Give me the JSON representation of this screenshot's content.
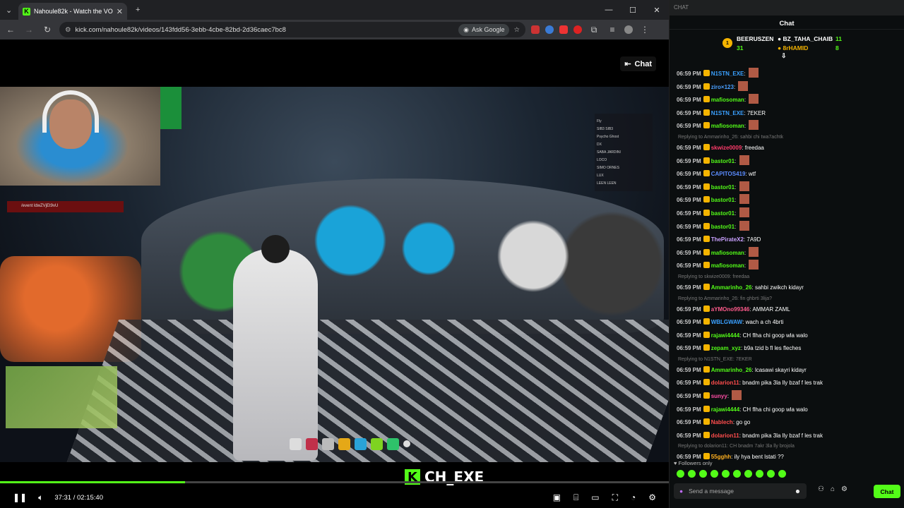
{
  "browser": {
    "tab_title": "Nahoule82k - Watch the VO",
    "url": "kick.com/nahoule82k/videos/143fdd56-3ebb-4cbe-82bd-2d36caec7bc8",
    "ask_google": "Ask Google"
  },
  "player": {
    "chat_toggle": "Chat",
    "game_command": "/event ldwZVjEt9vU",
    "brand_text": "CH_EXE",
    "brand_letter": "K",
    "time_current": "37:31",
    "time_separator": "/",
    "time_total": "02:15:40",
    "progress_percent": 27.7,
    "player_list": [
      "Fly",
      "SIB3 SIB3",
      "Psycho Ghost",
      "DX",
      "SABA JARDINI",
      "LOCO",
      "SIMO ORNES",
      "LUX",
      "LEEN LEEN"
    ]
  },
  "chat": {
    "header_label": "CHAT",
    "title": "Chat",
    "top_gifter_rank": "1",
    "gifters": [
      {
        "name": "BEERUSZEN",
        "count": "31"
      },
      {
        "name": "BZ_TAHA_CHAIB",
        "count": "11"
      },
      {
        "name": "8rHAMID",
        "count": "8"
      }
    ],
    "messages": [
      {
        "time": "06:59 PM",
        "user": "N1STN_EXE",
        "text": "",
        "color": "#3aa0ff",
        "emote": true,
        "reply": ""
      },
      {
        "time": "06:59 PM",
        "user": "ziro×123",
        "text": "",
        "color": "#4a9fff",
        "emote": true,
        "reply": ""
      },
      {
        "time": "06:59 PM",
        "user": "mafiosoman",
        "text": "",
        "color": "#53fc18",
        "emote": true,
        "reply": ""
      },
      {
        "time": "06:59 PM",
        "user": "N1STN_EXE",
        "text": "7EKER",
        "color": "#3aa0ff",
        "emote": false,
        "reply": ""
      },
      {
        "time": "06:59 PM",
        "user": "mafiosoman",
        "text": "",
        "color": "#53fc18",
        "emote": true,
        "reply": ""
      },
      {
        "time": "06:59 PM",
        "user": "skwize0009",
        "text": "freedaa",
        "color": "#ff3b6b",
        "emote": false,
        "reply": "Replying to Ammarinho_26: sahbi chi twa7achtk"
      },
      {
        "time": "06:59 PM",
        "user": "bastor01",
        "text": "",
        "color": "#53fc18",
        "emote": true,
        "reply": ""
      },
      {
        "time": "06:59 PM",
        "user": "CAPITOS419",
        "text": "wtf",
        "color": "#5b8cff",
        "emote": false,
        "reply": ""
      },
      {
        "time": "06:59 PM",
        "user": "bastor01",
        "text": "",
        "color": "#53fc18",
        "emote": true,
        "reply": ""
      },
      {
        "time": "06:59 PM",
        "user": "bastor01",
        "text": "",
        "color": "#53fc18",
        "emote": true,
        "reply": ""
      },
      {
        "time": "06:59 PM",
        "user": "bastor01",
        "text": "",
        "color": "#53fc18",
        "emote": true,
        "reply": ""
      },
      {
        "time": "06:59 PM",
        "user": "bastor01",
        "text": "",
        "color": "#53fc18",
        "emote": true,
        "reply": ""
      },
      {
        "time": "06:59 PM",
        "user": "ThePirateX2",
        "text": "7A9D",
        "color": "#c9a0ff",
        "emote": false,
        "reply": ""
      },
      {
        "time": "06:59 PM",
        "user": "mafiosoman",
        "text": "",
        "color": "#53fc18",
        "emote": true,
        "reply": ""
      },
      {
        "time": "06:59 PM",
        "user": "mafiosoman",
        "text": "",
        "color": "#53fc18",
        "emote": true,
        "reply": ""
      },
      {
        "time": "06:59 PM",
        "user": "Ammarinho_26",
        "text": "sahbi zwikch kidayr",
        "color": "#53fc18",
        "emote": false,
        "reply": "Replying to skwize0009: freedaa"
      },
      {
        "time": "06:59 PM",
        "user": "aYMOno99346",
        "text": "AMMAR ZAML",
        "color": "#ff5b8c",
        "emote": false,
        "reply": "Replying to Ammarinho_26: fin ghbrti 3lija?"
      },
      {
        "time": "06:59 PM",
        "user": "WBLGWAW",
        "text": "wach a ch 4brti",
        "color": "#3aa0ff",
        "emote": false,
        "reply": ""
      },
      {
        "time": "06:59 PM",
        "user": "rajawi4444",
        "text": "CH flha chi goop wla walo",
        "color": "#53fc18",
        "emote": false,
        "reply": ""
      },
      {
        "time": "06:59 PM",
        "user": "zepam_xyz",
        "text": "b9a tzid b fl les fleches",
        "color": "#53fc18",
        "emote": false,
        "reply": ""
      },
      {
        "time": "06:59 PM",
        "user": "Ammarinho_26",
        "text": "lcasawi skayri kidayr",
        "color": "#53fc18",
        "emote": false,
        "reply": "Replying to N1STN_EXE: 7EKER"
      },
      {
        "time": "06:59 PM",
        "user": "dolarion11",
        "text": "bnadm pika 3la lly bzaf f les trak",
        "color": "#ff4d4d",
        "emote": false,
        "reply": ""
      },
      {
        "time": "06:59 PM",
        "user": "sunyy",
        "text": "",
        "color": "#ff4da6",
        "emote": true,
        "reply": ""
      },
      {
        "time": "06:59 PM",
        "user": "rajawi4444",
        "text": "CH flha chi goop wla walo",
        "color": "#53fc18",
        "emote": false,
        "reply": ""
      },
      {
        "time": "06:59 PM",
        "user": "Nablech",
        "text": "go go",
        "color": "#ff4d4d",
        "emote": false,
        "reply": ""
      },
      {
        "time": "06:59 PM",
        "user": "dolarion11",
        "text": "bnadm pika 3la lly bzaf f les trak",
        "color": "#ff4d4d",
        "emote": false,
        "reply": ""
      },
      {
        "time": "06:59 PM",
        "user": "55gghh",
        "text": "ily hya bent lstati ??",
        "color": "#ffb020",
        "emote": false,
        "reply": "Replying to dolarion11: CH bnadm 7akr 3la lly brojola"
      }
    ],
    "followers_only": "Followers only",
    "input_placeholder": "Send a message",
    "send_label": "Chat"
  },
  "colors": {
    "brand": "#53fc18",
    "chat_bg": "#0b0e0f"
  }
}
